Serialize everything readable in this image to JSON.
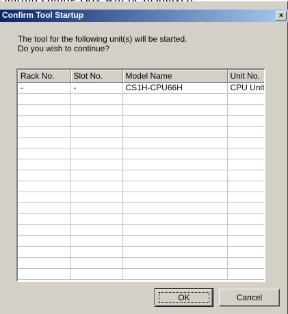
{
  "page_caption": "Startup Dialog Box will be displayed.",
  "dialog": {
    "title": "Confirm Tool Startup",
    "close_glyph": "×",
    "message_line1": "The tool for the following unit(s) will be started.",
    "message_line2": "Do you wish to continue?"
  },
  "table": {
    "columns": [
      "Rack No.",
      "Slot No.",
      "Model Name",
      "Unit No."
    ],
    "rows": [
      [
        "-",
        "-",
        "CS1H-CPU66H",
        "CPU Unit"
      ]
    ]
  },
  "buttons": {
    "ok": "OK",
    "cancel": "Cancel"
  }
}
